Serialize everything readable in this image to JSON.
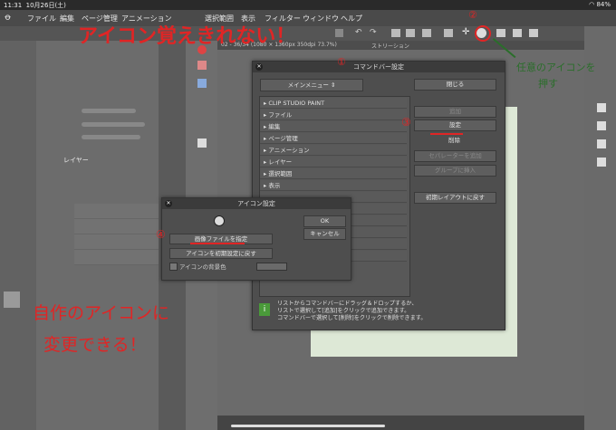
{
  "status": {
    "time": "11:31",
    "date": "10月26日(土)",
    "battery": "84%"
  },
  "menu": [
    "ファイル",
    "編集",
    "ページ管理",
    "アニメーション",
    "選択範囲",
    "表示",
    "フィルター",
    "ウィンドウ",
    "ヘルプ"
  ],
  "canvas_tab": "02 - 36/34 (1080 × 1360px 350dpi 73.7%)",
  "canvas_tab_secondary": "ストリーション",
  "layer_panel": {
    "header": "レイヤー"
  },
  "command_bar_dialog": {
    "title": "コマンドバー設定",
    "dropdown": "メインメニュー",
    "close_button": "閉じる",
    "add_button": "追加",
    "settings_button": "設定",
    "delete_button": "削除",
    "add_separator_button": "セパレーターを追加",
    "add_group_button": "グループに挿入",
    "reset_layout_button": "初期レイアウトに戻す",
    "tree": [
      "CLIP STUDIO PAINT",
      "ファイル",
      "編集",
      "ページ管理",
      "アニメーション",
      "レイヤー",
      "選択範囲",
      "表示"
    ],
    "help_text": [
      "リストからコマンドバーにドラッグ＆ドロップするか、",
      "リストで選択して[追加]をクリックで追加できます。",
      "コマンドバーで選択して[削除]をクリックで削除できます。"
    ]
  },
  "icon_dialog": {
    "title": "アイコン設定",
    "ok": "OK",
    "cancel": "キャンセル",
    "specify_image": "画像ファイルを指定",
    "reset_icon": "アイコンを初期設定に戻す",
    "bg_color_label": "アイコンの背景色"
  },
  "annotations": {
    "top_title": "アイコン覚えきれない！",
    "n1": "①",
    "n2": "②",
    "n3": "③",
    "n4": "④",
    "right_note_1": "任意のアイコンを",
    "right_note_2": "押す",
    "bottom_1": "自作のアイコンに",
    "bottom_2": "変更できる！"
  },
  "colors": {
    "annotation_red": "#e02525",
    "annotation_green": "#2a6e2a",
    "paper": "#dde8d6"
  }
}
